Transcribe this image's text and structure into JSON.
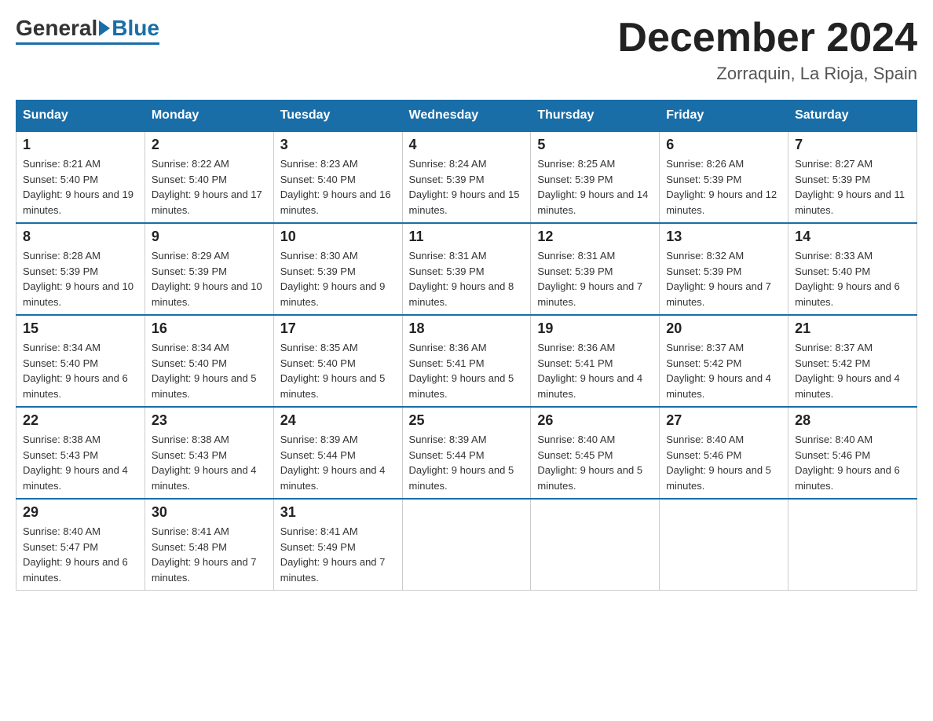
{
  "header": {
    "logo_general": "General",
    "logo_blue": "Blue",
    "month_title": "December 2024",
    "location": "Zorraquin, La Rioja, Spain"
  },
  "days_of_week": [
    "Sunday",
    "Monday",
    "Tuesday",
    "Wednesday",
    "Thursday",
    "Friday",
    "Saturday"
  ],
  "weeks": [
    [
      {
        "day": "1",
        "sunrise": "8:21 AM",
        "sunset": "5:40 PM",
        "daylight": "9 hours and 19 minutes."
      },
      {
        "day": "2",
        "sunrise": "8:22 AM",
        "sunset": "5:40 PM",
        "daylight": "9 hours and 17 minutes."
      },
      {
        "day": "3",
        "sunrise": "8:23 AM",
        "sunset": "5:40 PM",
        "daylight": "9 hours and 16 minutes."
      },
      {
        "day": "4",
        "sunrise": "8:24 AM",
        "sunset": "5:39 PM",
        "daylight": "9 hours and 15 minutes."
      },
      {
        "day": "5",
        "sunrise": "8:25 AM",
        "sunset": "5:39 PM",
        "daylight": "9 hours and 14 minutes."
      },
      {
        "day": "6",
        "sunrise": "8:26 AM",
        "sunset": "5:39 PM",
        "daylight": "9 hours and 12 minutes."
      },
      {
        "day": "7",
        "sunrise": "8:27 AM",
        "sunset": "5:39 PM",
        "daylight": "9 hours and 11 minutes."
      }
    ],
    [
      {
        "day": "8",
        "sunrise": "8:28 AM",
        "sunset": "5:39 PM",
        "daylight": "9 hours and 10 minutes."
      },
      {
        "day": "9",
        "sunrise": "8:29 AM",
        "sunset": "5:39 PM",
        "daylight": "9 hours and 10 minutes."
      },
      {
        "day": "10",
        "sunrise": "8:30 AM",
        "sunset": "5:39 PM",
        "daylight": "9 hours and 9 minutes."
      },
      {
        "day": "11",
        "sunrise": "8:31 AM",
        "sunset": "5:39 PM",
        "daylight": "9 hours and 8 minutes."
      },
      {
        "day": "12",
        "sunrise": "8:31 AM",
        "sunset": "5:39 PM",
        "daylight": "9 hours and 7 minutes."
      },
      {
        "day": "13",
        "sunrise": "8:32 AM",
        "sunset": "5:39 PM",
        "daylight": "9 hours and 7 minutes."
      },
      {
        "day": "14",
        "sunrise": "8:33 AM",
        "sunset": "5:40 PM",
        "daylight": "9 hours and 6 minutes."
      }
    ],
    [
      {
        "day": "15",
        "sunrise": "8:34 AM",
        "sunset": "5:40 PM",
        "daylight": "9 hours and 6 minutes."
      },
      {
        "day": "16",
        "sunrise": "8:34 AM",
        "sunset": "5:40 PM",
        "daylight": "9 hours and 5 minutes."
      },
      {
        "day": "17",
        "sunrise": "8:35 AM",
        "sunset": "5:40 PM",
        "daylight": "9 hours and 5 minutes."
      },
      {
        "day": "18",
        "sunrise": "8:36 AM",
        "sunset": "5:41 PM",
        "daylight": "9 hours and 5 minutes."
      },
      {
        "day": "19",
        "sunrise": "8:36 AM",
        "sunset": "5:41 PM",
        "daylight": "9 hours and 4 minutes."
      },
      {
        "day": "20",
        "sunrise": "8:37 AM",
        "sunset": "5:42 PM",
        "daylight": "9 hours and 4 minutes."
      },
      {
        "day": "21",
        "sunrise": "8:37 AM",
        "sunset": "5:42 PM",
        "daylight": "9 hours and 4 minutes."
      }
    ],
    [
      {
        "day": "22",
        "sunrise": "8:38 AM",
        "sunset": "5:43 PM",
        "daylight": "9 hours and 4 minutes."
      },
      {
        "day": "23",
        "sunrise": "8:38 AM",
        "sunset": "5:43 PM",
        "daylight": "9 hours and 4 minutes."
      },
      {
        "day": "24",
        "sunrise": "8:39 AM",
        "sunset": "5:44 PM",
        "daylight": "9 hours and 4 minutes."
      },
      {
        "day": "25",
        "sunrise": "8:39 AM",
        "sunset": "5:44 PM",
        "daylight": "9 hours and 5 minutes."
      },
      {
        "day": "26",
        "sunrise": "8:40 AM",
        "sunset": "5:45 PM",
        "daylight": "9 hours and 5 minutes."
      },
      {
        "day": "27",
        "sunrise": "8:40 AM",
        "sunset": "5:46 PM",
        "daylight": "9 hours and 5 minutes."
      },
      {
        "day": "28",
        "sunrise": "8:40 AM",
        "sunset": "5:46 PM",
        "daylight": "9 hours and 6 minutes."
      }
    ],
    [
      {
        "day": "29",
        "sunrise": "8:40 AM",
        "sunset": "5:47 PM",
        "daylight": "9 hours and 6 minutes."
      },
      {
        "day": "30",
        "sunrise": "8:41 AM",
        "sunset": "5:48 PM",
        "daylight": "9 hours and 7 minutes."
      },
      {
        "day": "31",
        "sunrise": "8:41 AM",
        "sunset": "5:49 PM",
        "daylight": "9 hours and 7 minutes."
      },
      null,
      null,
      null,
      null
    ]
  ]
}
